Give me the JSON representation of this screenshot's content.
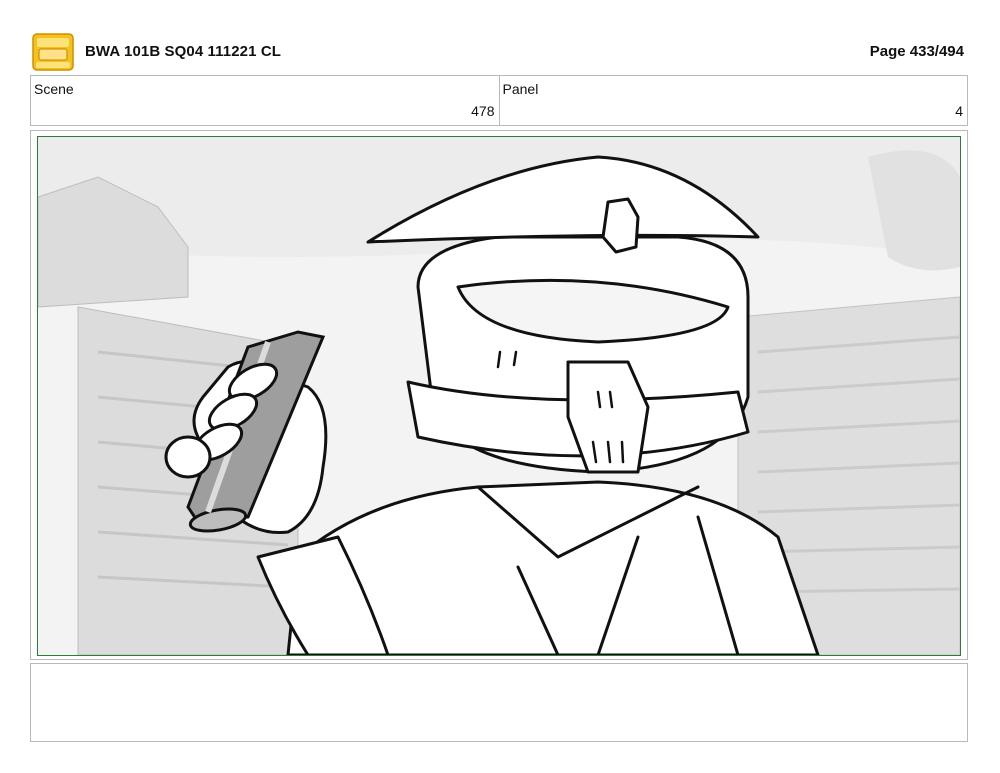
{
  "header": {
    "title": "BWA 101B SQ04 111221 CL",
    "page_label": "Page 433/494",
    "logo_icon": "young-jedi-adventures-logo"
  },
  "info": {
    "scene_label": "Scene",
    "scene_value": "478",
    "panel_label": "Panel",
    "panel_value": "4"
  },
  "panel": {
    "image_icon": "storyboard-sketch-clone-trooper-holding-canister",
    "border_color": "#2e7d32"
  },
  "notes": {
    "text": ""
  }
}
